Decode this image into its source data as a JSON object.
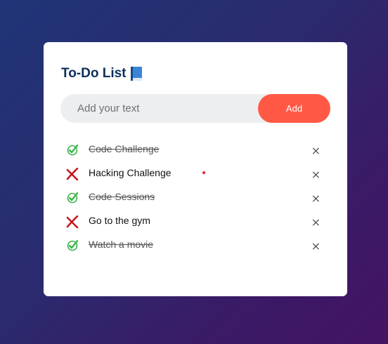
{
  "app": {
    "title": "To-Do List",
    "title_icon": "book-icon"
  },
  "input": {
    "placeholder": "Add your text",
    "value": ""
  },
  "add_button": {
    "label": "Add",
    "color": "#ff5945"
  },
  "tasks": [
    {
      "text": "Code Challenge",
      "done": true,
      "status_icon": "check-icon",
      "remove_label": "×"
    },
    {
      "text": "Hacking Challenge",
      "done": false,
      "status_icon": "cross-icon",
      "remove_label": "×"
    },
    {
      "text": "Code Sessions",
      "done": true,
      "status_icon": "check-icon",
      "remove_label": "×"
    },
    {
      "text": "Go to the gym",
      "done": false,
      "status_icon": "cross-icon",
      "remove_label": "×"
    },
    {
      "text": "Watch a movie",
      "done": true,
      "status_icon": "check-icon",
      "remove_label": "×"
    }
  ],
  "colors": {
    "title": "#0b2f5c",
    "check": "#3bb54a",
    "cross": "#c8161d"
  }
}
